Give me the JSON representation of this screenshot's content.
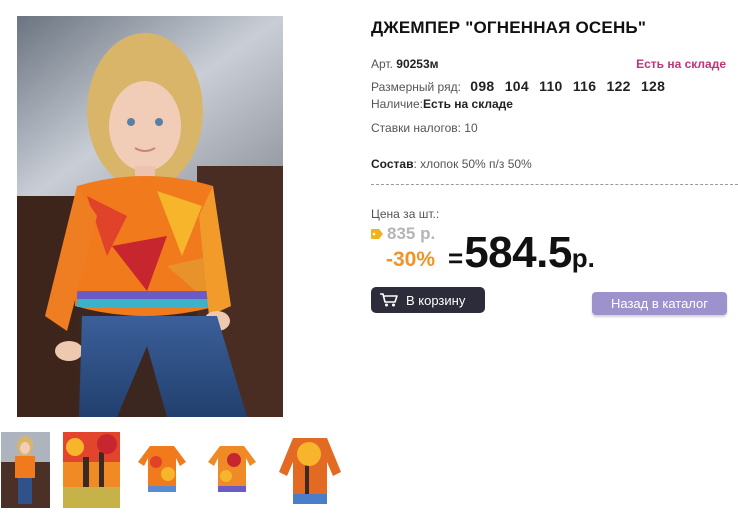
{
  "product": {
    "title": "ДЖЕМПЕР \"ОГНЕННАЯ ОСЕНЬ\"",
    "article_label": "Арт.",
    "article_value": "90253м",
    "stock_badge": "Есть на складе",
    "sizes_label": "Размерный ряд:",
    "sizes": "098 104 110 116 122 128",
    "availability_label": "Наличие:",
    "availability_value": "Есть на складе",
    "tax_text": "Ставки налогов: 10",
    "composition_label": "Состав",
    "composition_value": ": хлопок 50% п/з 50%"
  },
  "price": {
    "label": "Цена за шт.:",
    "old": "835 р.",
    "discount": "-30%",
    "eq": "=",
    "new": "584.5",
    "currency": "р."
  },
  "buttons": {
    "cart": "В корзину",
    "back": "Назад в каталог"
  },
  "icons": {
    "tag": "price-tag-icon",
    "cart": "shopping-cart-icon"
  },
  "colors": {
    "stock": "#c0337a",
    "discount": "#f39323",
    "cart_button": "#2d2c3a",
    "back_button": "#9e92cc"
  }
}
